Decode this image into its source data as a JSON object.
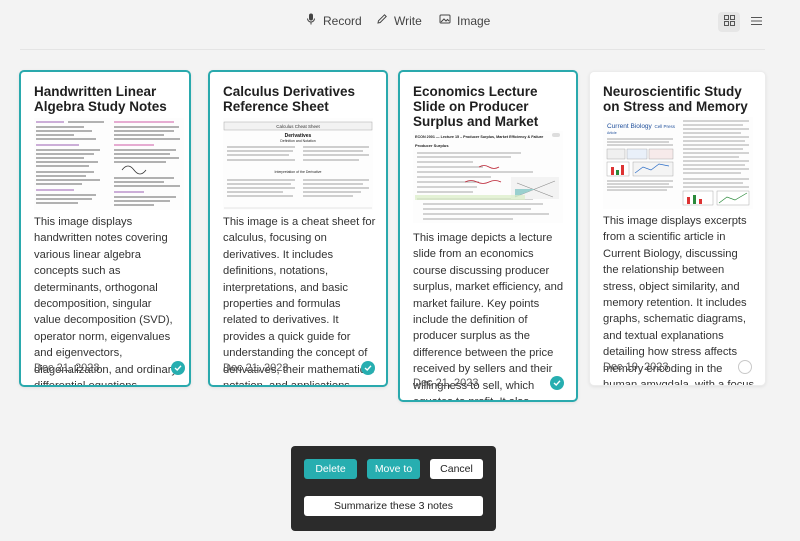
{
  "toolbar": {
    "record_label": "Record",
    "write_label": "Write",
    "image_label": "Image"
  },
  "cards": [
    {
      "title": "Handwritten Linear Algebra Study Notes",
      "description": "This image displays handwritten notes covering various linear algebra concepts such as determinants, orthogonal decomposition, singular value decomposition (SVD), operator norm, eigenvalues and eigenvectors, diagonalization, and ordinary differential equations (ODEs). The notes include equations, explanations, and diagrams to ...",
      "date": "Dec 21, 2023",
      "selected": true
    },
    {
      "title": "Calculus Derivatives Reference Sheet",
      "description": "This image is a cheat sheet for calculus, focusing on derivatives. It includes definitions, notations, interpretations, and basic properties and formulas related to derivatives. It provides a quick guide for understanding the concept of derivatives, their mathematical notation, and applications such as slope of tangent lines, rates of ...",
      "date": "Dec 21, 2023",
      "selected": true
    },
    {
      "title": "Economics Lecture Slide on Producer Surplus and Market Efficiency",
      "description": "This image depicts a lecture slide from an economics course discussing producer surplus, market efficiency, and market failure. Key points include the definition of producer surplus as the difference between the price received by sellers and their willingness to sell, which equates to profit. It also outlines how total producer surplus is calculated as th...",
      "date": "Dec 21, 2023",
      "selected": true
    },
    {
      "title": "Neuroscientific Study on Stress and Memory",
      "description": "This image displays excerpts from a scientific article in Current Biology, discussing the relationship between stress, object similarity, and memory retention. It includes graphs, schematic diagrams, and textual explanations detailing how stress affects memory encoding in the human amygdala, with a focus on the distinction between central and ...",
      "date": "Dec 19, 2023",
      "selected": false
    }
  ],
  "thumbs": {
    "calc_header": "Calculus Cheat Sheet",
    "calc_heading": "Derivatives",
    "calc_sub1": "Definition and Notation",
    "calc_sub2": "Interpretation of the Derivative",
    "econ_header": "ECON 2001 — Lecture 15 – Producer Surplus, Market Efficiency & Failure",
    "econ_sub": "Producer Surplus",
    "bio_journal": "Current Biology",
    "bio_article": "Article",
    "bio_publisher": "Cell Press"
  },
  "actions": {
    "delete_label": "Delete",
    "move_label": "Move to",
    "cancel_label": "Cancel",
    "summarize_label": "Summarize these 3 notes"
  },
  "colors": {
    "accent": "#27aeb0",
    "panel": "#2b2b2b",
    "background": "#f3f3f3"
  }
}
